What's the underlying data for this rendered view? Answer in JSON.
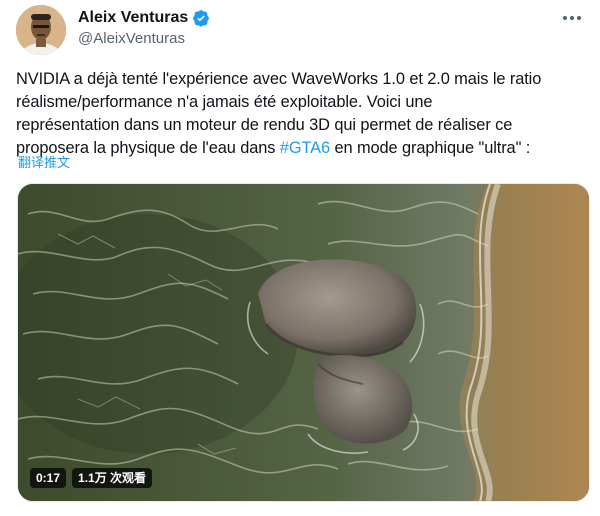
{
  "author": {
    "display_name": "Aleix Venturas",
    "handle": "@AleixVenturas",
    "verified": true,
    "avatar_icon": "avatar-character-icon"
  },
  "tweet": {
    "text_lines": [
      "NVIDIA a déjà tenté l'expérience avec WaveWorks 1.0 et 2.0 mais le ratio",
      "réalisme/performance n'a jamais été exploitable. Voici une",
      "représentation dans un moteur de rendu 3D qui permet de réaliser ce"
    ],
    "last_line_before": "proposera la physique de l'eau dans ",
    "hashtag": "#GTA6",
    "last_line_after": " en mode graphique \"ultra\" :",
    "translate_label": "翻译推文"
  },
  "video": {
    "duration": "0:17",
    "views": "1.1万 次观看"
  },
  "colors": {
    "link": "#1d9bf0",
    "verified": "#1d9bf0",
    "secondary_text": "#536471",
    "primary_text": "#0f1419"
  }
}
